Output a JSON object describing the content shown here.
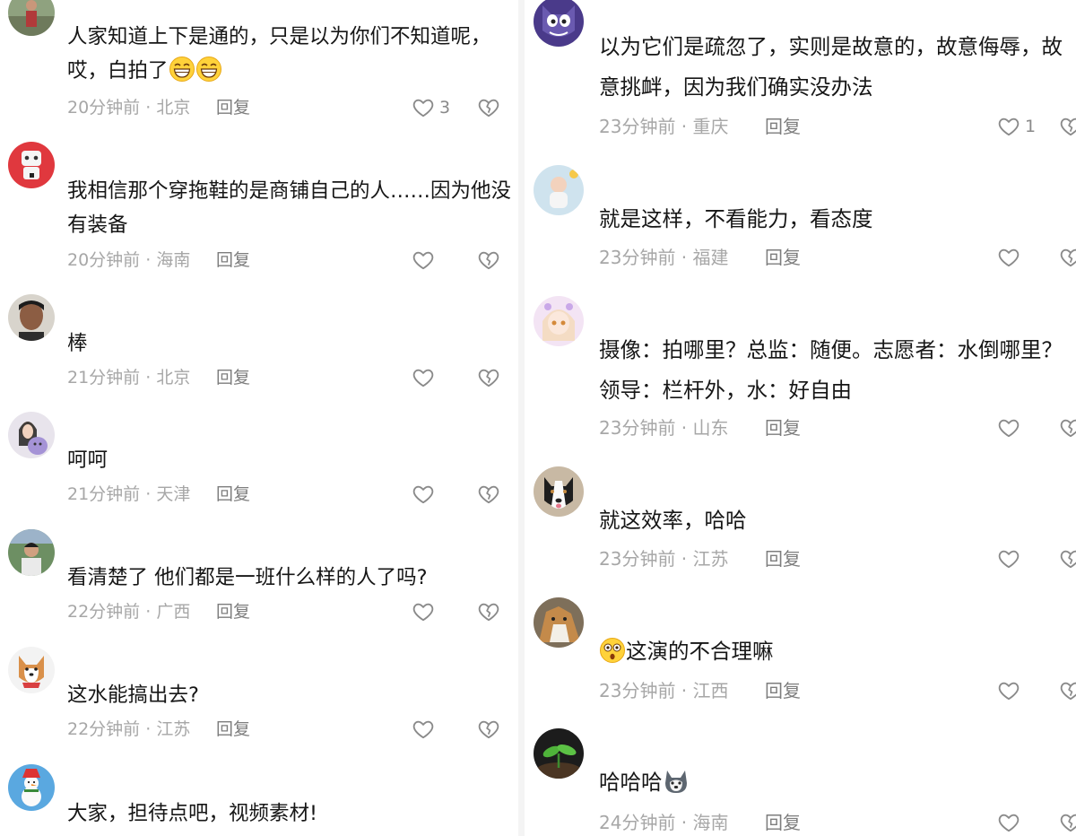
{
  "left_comments": [
    {
      "avatar_icon": "avatar-person-outdoor",
      "text": "人家知道上下是通的，只是以为你们不知道呢，哎，白拍了",
      "emoji": [
        "grin-emoji",
        "grin-emoji"
      ],
      "time": "20分钟前",
      "location": "北京",
      "reply": "回复",
      "likes": "3"
    },
    {
      "avatar_icon": "avatar-robot-logo",
      "text": "我相信那个穿拖鞋的是商铺自己的人……因为他没有装备",
      "time": "20分钟前",
      "location": "海南",
      "reply": "回复",
      "likes": ""
    },
    {
      "avatar_icon": "avatar-man-portrait",
      "text": "棒",
      "time": "21分钟前",
      "location": "北京",
      "reply": "回复",
      "likes": ""
    },
    {
      "avatar_icon": "avatar-girl-with-toy",
      "text": "呵呵",
      "time": "21分钟前",
      "location": "天津",
      "reply": "回复",
      "likes": ""
    },
    {
      "avatar_icon": "avatar-man-outdoor",
      "text": "看清楚了 他们都是一班什么样的人了吗?",
      "time": "22分钟前",
      "location": "广西",
      "reply": "回复",
      "likes": ""
    },
    {
      "avatar_icon": "avatar-dog-cartoon",
      "text": "这水能搞出去?",
      "time": "22分钟前",
      "location": "江苏",
      "reply": "回复",
      "likes": ""
    },
    {
      "avatar_icon": "avatar-snowman",
      "text": "大家，担待点吧，视频素材!",
      "time": "",
      "location": "",
      "reply": "",
      "likes": ""
    }
  ],
  "right_comments": [
    {
      "avatar_icon": "avatar-cartoon-cat",
      "text": "以为它们是疏忽了，实则是故意的，故意侮辱，故意挑衅，因为我们确实没办法",
      "time": "23分钟前",
      "location": "重庆",
      "reply": "回复",
      "likes": "1"
    },
    {
      "avatar_icon": "avatar-baby",
      "text": "就是这样，不看能力，看态度",
      "time": "23分钟前",
      "location": "福建",
      "reply": "回复",
      "likes": ""
    },
    {
      "avatar_icon": "avatar-anime-girl",
      "text": "摄像：拍哪里？总监：随便。志愿者：水倒哪里？领导：栏杆外，水：好自由",
      "time": "23分钟前",
      "location": "山东",
      "reply": "回复",
      "likes": ""
    },
    {
      "avatar_icon": "avatar-border-collie",
      "text": "就这效率，哈哈",
      "time": "23分钟前",
      "location": "江苏",
      "reply": "回复",
      "likes": ""
    },
    {
      "avatar_icon": "avatar-dog-photo",
      "prefix_emoji": "surprised-emoji",
      "text": "这演的不合理嘛",
      "time": "23分钟前",
      "location": "江西",
      "reply": "回复",
      "likes": ""
    },
    {
      "avatar_icon": "avatar-plant-sprout",
      "text": "哈哈哈",
      "suffix_emoji": "husky-emoji",
      "time": "24分钟前",
      "location": "海南",
      "reply": "回复",
      "likes": ""
    }
  ],
  "meta_separator": " · ",
  "colors": {
    "text": "#161616",
    "meta": "#a7a7a7",
    "reply": "#7d7d7d",
    "icon": "#8a8a8a",
    "background": "#ffffff"
  }
}
